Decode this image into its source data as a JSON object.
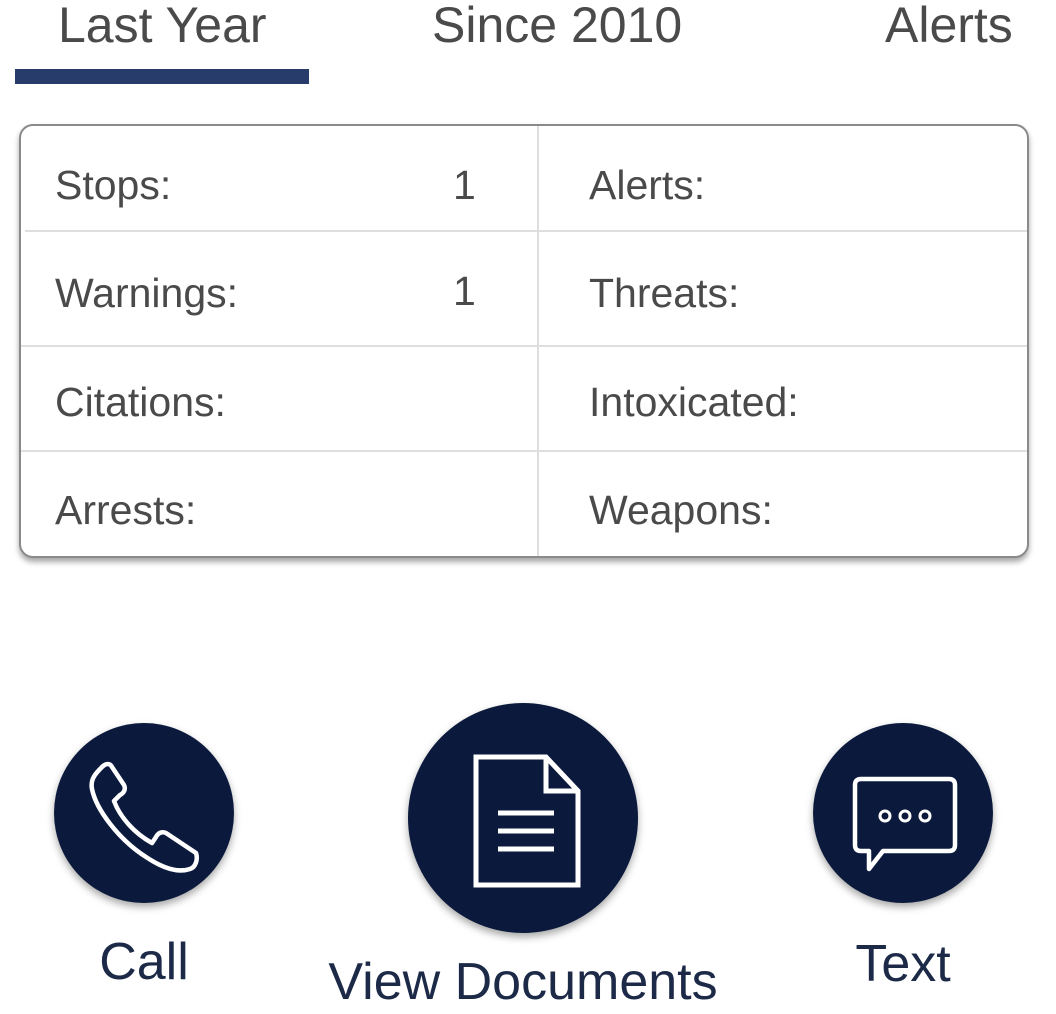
{
  "tabs": [
    {
      "label": "Last Year",
      "active": true
    },
    {
      "label": "Since 2010",
      "active": false
    },
    {
      "label": "Alerts",
      "active": false
    }
  ],
  "colors": {
    "tab_underline": "#283c6b",
    "button_fill": "#0b1a3c",
    "button_label": "#1c2a48"
  },
  "stats": {
    "left": [
      {
        "label": "Stops:",
        "value": "1"
      },
      {
        "label": "Warnings:",
        "value": "1"
      },
      {
        "label": "Citations:",
        "value": ""
      },
      {
        "label": "Arrests:",
        "value": ""
      }
    ],
    "right": [
      {
        "label": "Alerts:",
        "value": ""
      },
      {
        "label": "Threats:",
        "value": ""
      },
      {
        "label": "Intoxicated:",
        "value": ""
      },
      {
        "label": "Weapons:",
        "value": ""
      }
    ]
  },
  "actions": [
    {
      "label": "Call",
      "icon": "phone-icon"
    },
    {
      "label": "View Documents",
      "icon": "document-icon"
    },
    {
      "label": "Text",
      "icon": "chat-bubble-icon"
    }
  ]
}
